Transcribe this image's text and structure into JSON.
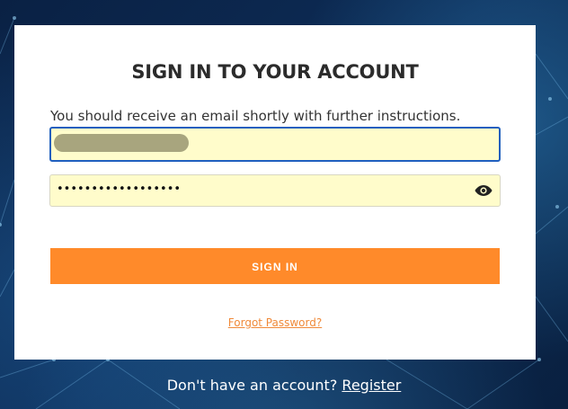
{
  "form": {
    "title": "SIGN IN TO YOUR ACCOUNT",
    "message": "You should receive an email shortly with further instructions.",
    "email_value": "",
    "password_value": "••••••••••••••••••",
    "submit_label": "SIGN IN",
    "forgot_label": "Forgot Password?"
  },
  "footer": {
    "prompt": "Don't have an account?",
    "register_label": "Register"
  },
  "colors": {
    "accent": "#ff8a2a",
    "field_bg": "#fffccb",
    "focus_border": "#1f5fbf",
    "background": "#0b2347"
  },
  "icons": {
    "password_toggle": "eye-icon"
  }
}
